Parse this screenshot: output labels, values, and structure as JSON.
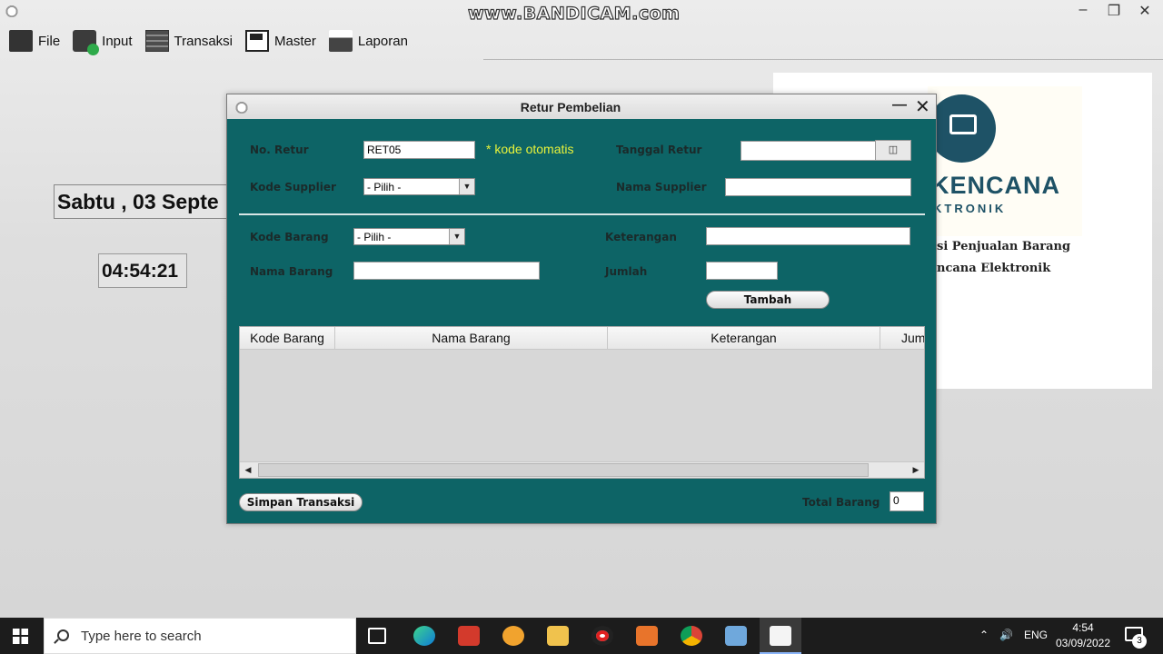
{
  "watermark": "www.BANDICAM.com",
  "menu": [
    {
      "label": "File"
    },
    {
      "label": "Input"
    },
    {
      "label": "Transaksi"
    },
    {
      "label": "Master"
    },
    {
      "label": "Laporan"
    }
  ],
  "main": {
    "date_text": "Sabtu , 03 Septe",
    "time_text": "04:54:21",
    "logo_text": "KENCANA",
    "logo_sub": "KTRONIK",
    "logo_line1": "si Penjualan Barang",
    "logo_line2": "ncana Elektronik",
    "logo_color": "#1e5266"
  },
  "dialog": {
    "title": "Retur Pembelian",
    "labels": {
      "no_retur": "No. Retur",
      "kode_supplier": "Kode Supplier",
      "tanggal_retur": "Tanggal Retur",
      "nama_supplier": "Nama Supplier",
      "kode_barang": "Kode Barang",
      "nama_barang": "Nama Barang",
      "keterangan": "Keterangan",
      "jumlah": "Jumlah",
      "total_barang": "Total Barang"
    },
    "values": {
      "no_retur": "RET05",
      "tanggal_retur": "",
      "nama_supplier": "",
      "nama_barang": "",
      "keterangan": "",
      "jumlah": "",
      "total_barang": "0"
    },
    "note": "* kode otomatis",
    "kode_supplier_selected": "- Pilih -",
    "kode_barang_selected": "- Pilih -",
    "buttons": {
      "tambah": "Tambah",
      "simpan": "Simpan Transaksi"
    },
    "table": {
      "columns": [
        "Kode Barang",
        "Nama Barang",
        "Keterangan",
        "Jum"
      ],
      "rows": []
    },
    "bg_color": "#0d6466",
    "note_color": "#e8f23a"
  },
  "taskbar": {
    "search_placeholder": "Type here to search",
    "lang": "ENG",
    "time": "4:54",
    "date": "03/09/2022",
    "notification_count": "3"
  }
}
